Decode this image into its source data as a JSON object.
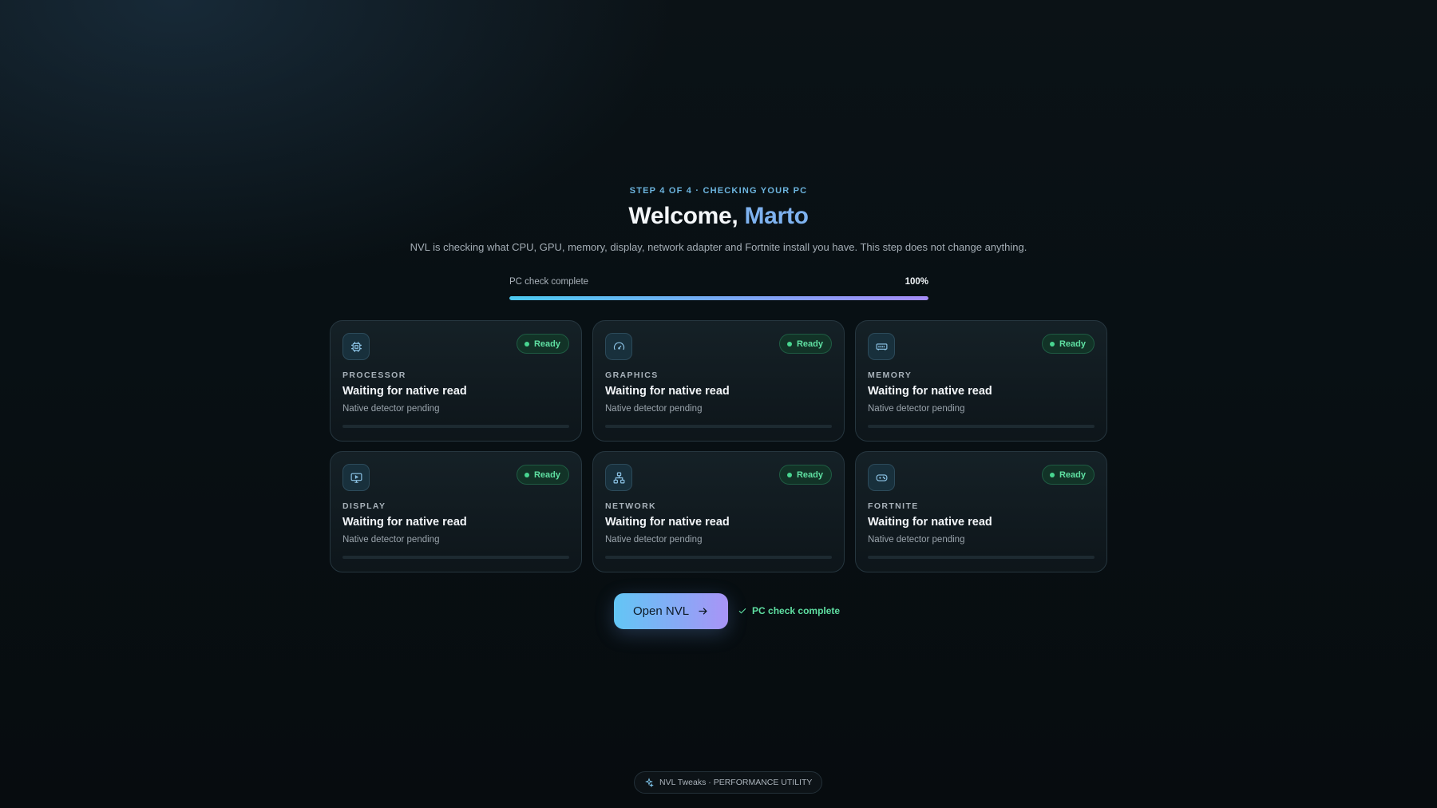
{
  "header": {
    "step": "STEP 4 OF 4 · CHECKING YOUR PC",
    "title_prefix": "Welcome, ",
    "title_name": "Marto",
    "subtitle": "NVL is checking what CPU, GPU, memory, display, network adapter and Fortnite install you have. This step does not change anything."
  },
  "progress": {
    "label": "PC check complete",
    "value_text": "100%",
    "fraction": 1.0
  },
  "cards": [
    {
      "icon": "cpu-icon",
      "category": "PROCESSOR",
      "status": "Ready",
      "heading": "Waiting for native read",
      "detail": "Native detector pending"
    },
    {
      "icon": "gauge-icon",
      "category": "GRAPHICS",
      "status": "Ready",
      "heading": "Waiting for native read",
      "detail": "Native detector pending"
    },
    {
      "icon": "memory-icon",
      "category": "MEMORY",
      "status": "Ready",
      "heading": "Waiting for native read",
      "detail": "Native detector pending"
    },
    {
      "icon": "monitor-icon",
      "category": "DISPLAY",
      "status": "Ready",
      "heading": "Waiting for native read",
      "detail": "Native detector pending"
    },
    {
      "icon": "network-icon",
      "category": "NETWORK",
      "status": "Ready",
      "heading": "Waiting for native read",
      "detail": "Native detector pending"
    },
    {
      "icon": "gamepad-icon",
      "category": "FORTNITE",
      "status": "Ready",
      "heading": "Waiting for native read",
      "detail": "Native detector pending"
    }
  ],
  "actions": {
    "open_label": "Open NVL",
    "status_text": "PC check complete"
  },
  "footer": {
    "text": "NVL Tweaks · PERFORMANCE UTILITY"
  },
  "colors": {
    "accent": "#7eb2ef",
    "ready": "#5fe0a2",
    "background": "#081014"
  }
}
